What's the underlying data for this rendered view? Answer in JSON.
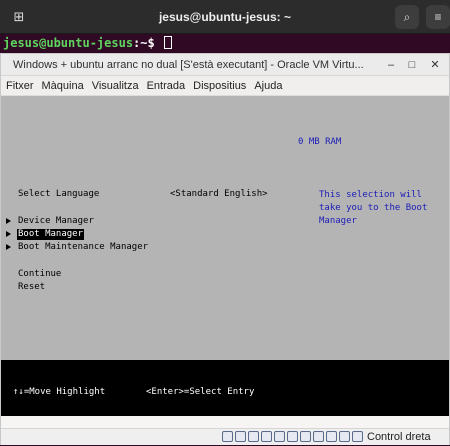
{
  "terminal": {
    "title": "jesus@ubuntu-jesus: ~",
    "prompt_user": "jesus@ubuntu-jesus",
    "prompt_sep": ":~$ "
  },
  "vbox": {
    "title": "Windows + ubuntu arranc no dual [S'està executant] - Oracle VM Virtu...",
    "menu": [
      "Fitxer",
      "Màquina",
      "Visualitza",
      "Entrada",
      "Dispositius",
      "Ajuda"
    ],
    "controls": {
      "minimize": "–",
      "maximize": "□",
      "close": "✕"
    }
  },
  "uefi": {
    "ram": "0 MB RAM",
    "select_language_label": "Select Language",
    "select_language_value": "<Standard English>",
    "help_text": "This selection will take you to the Boot Manager",
    "items": [
      "Device Manager",
      "Boot Manager",
      "Boot Maintenance Manager"
    ],
    "continue": "Continue",
    "reset": "Reset",
    "footer_move": "↑↓=Move Highlight",
    "footer_select": "<Enter>=Select Entry"
  },
  "statusbar": {
    "host_key": "Control dreta",
    "icons": [
      "hard-disk-icon",
      "optical-drive-icon",
      "audio-icon",
      "network-icon",
      "usb-icon",
      "shared-folders-icon",
      "display-icon",
      "recording-icon",
      "cpu-icon",
      "mouse-integration-icon",
      "keyboard-icon"
    ]
  }
}
